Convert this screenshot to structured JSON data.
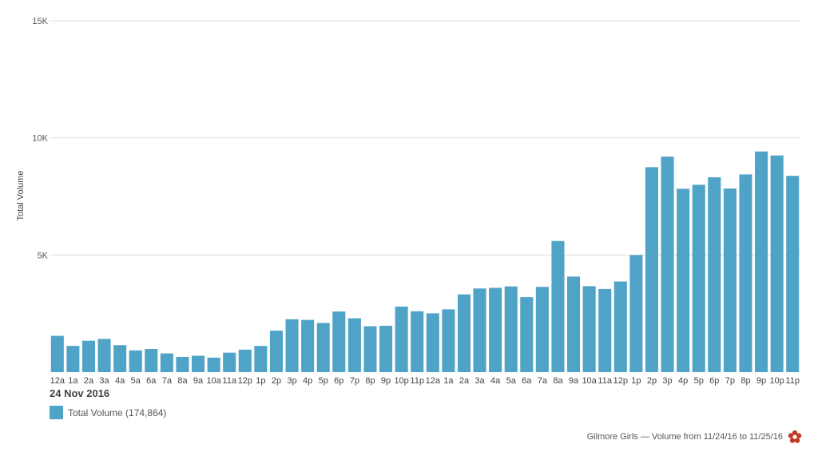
{
  "chart_data": {
    "type": "bar",
    "ylabel": "Total Volume",
    "ylim": [
      0,
      15000
    ],
    "yticks": [
      {
        "value": 5000,
        "label": "5K"
      },
      {
        "value": 10000,
        "label": "10K"
      },
      {
        "value": 15000,
        "label": "15K"
      }
    ],
    "grid": true,
    "date_label": "24 Nov 2016",
    "categories": [
      "12a",
      "1a",
      "2a",
      "3a",
      "4a",
      "5a",
      "6a",
      "7a",
      "8a",
      "9a",
      "10a",
      "11a",
      "12p",
      "1p",
      "2p",
      "3p",
      "4p",
      "5p",
      "6p",
      "7p",
      "8p",
      "9p",
      "10p",
      "11p",
      "12a",
      "1a",
      "2a",
      "3a",
      "4a",
      "5a",
      "6a",
      "7a",
      "8a",
      "9a",
      "10a",
      "11a",
      "12p",
      "1p",
      "2p",
      "3p",
      "4p",
      "5p",
      "6p",
      "7p",
      "8p",
      "9p",
      "10p",
      "11p"
    ],
    "series": [
      {
        "name": "Total Volume",
        "color": "#4fa3c7",
        "values": [
          1550,
          1120,
          1340,
          1420,
          1150,
          930,
          990,
          800,
          650,
          700,
          620,
          830,
          960,
          1120,
          1770,
          2260,
          2230,
          2100,
          2590,
          2300,
          1960,
          1980,
          2800,
          2600,
          2510,
          2680,
          3320,
          3570,
          3600,
          3660,
          3200,
          3640,
          5600,
          4080,
          3670,
          3550,
          3870,
          5000,
          8750,
          9200,
          7830,
          8000,
          8320,
          7840,
          8440,
          9420,
          9250,
          8380
        ]
      }
    ],
    "legend": {
      "position": "bottom-left",
      "label": "Total Volume (174,864)"
    },
    "footer": "Gilmore Girls — Volume from 11/24/16 to 11/25/16"
  }
}
